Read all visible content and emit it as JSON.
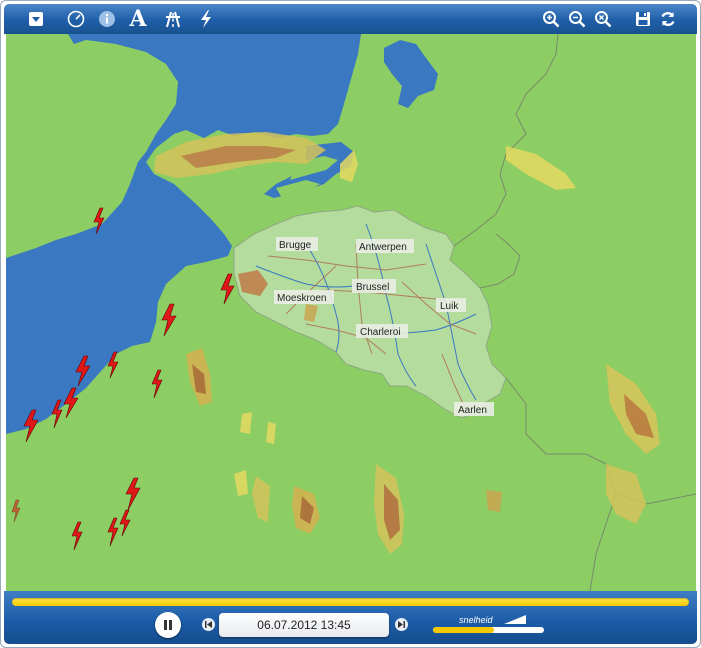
{
  "toolbar": {
    "left_icons": [
      "menu-dropdown-icon",
      "speedometer-icon",
      "info-icon",
      "label-toggle-icon",
      "highway-icon",
      "lightning-icon"
    ],
    "right_icons": [
      "zoom-in-icon",
      "zoom-out-icon",
      "zoom-reset-icon",
      "save-icon",
      "refresh-icon"
    ],
    "text_button": "A"
  },
  "map": {
    "cities": [
      "Brugge",
      "Antwerpen",
      "Brussel",
      "Moeskroen",
      "Luik",
      "Charleroi",
      "Aarlen"
    ],
    "colors": {
      "land": "#8ccd64",
      "sea": "#3a78c2",
      "belgium": "#b4dc9c",
      "lightning": "#e01818"
    }
  },
  "player": {
    "datetime": "06.07.2012 13:45",
    "progress": 1.0,
    "speed_label": "snelheid",
    "speed_level": 0.55
  }
}
